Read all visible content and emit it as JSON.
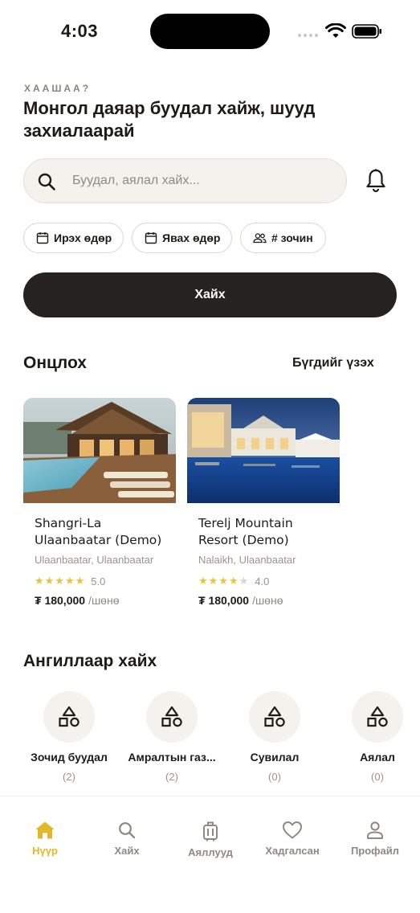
{
  "status_bar": {
    "time": "4:03"
  },
  "header": {
    "eyebrow": "ХААШАА?",
    "headline": "Монгол даяар буудал хайж, шууд захиалаарай"
  },
  "search": {
    "placeholder": "Буудал, аялал хайх..."
  },
  "filters": {
    "arrive": "Ирэх өдөр",
    "leave": "Явах өдөр",
    "guests": "# зочин"
  },
  "search_button": "Хайх",
  "featured": {
    "title": "Онцлох",
    "see_all": "Бүгдийг үзэх",
    "items": [
      {
        "name": "Shangri-La Ulaanbaatar (Demo)",
        "location": "Ulaanbaatar, Ulaanbaatar",
        "rating": "5.0",
        "stars": 5,
        "price": "₮ 180,000",
        "unit": "/шөнө"
      },
      {
        "name": "Terelj Mountain Resort (Demo)",
        "location": "Nalaikh, Ulaanbaatar",
        "rating": "4.0",
        "stars": 4,
        "price": "₮ 180,000",
        "unit": "/шөнө"
      }
    ]
  },
  "categories": {
    "title": "Ангиллаар хайх",
    "items": [
      {
        "label": "Зочид буудал",
        "count": "(2)"
      },
      {
        "label": "Амралтын газ...",
        "count": "(2)"
      },
      {
        "label": "Сувилал",
        "count": "(0)"
      },
      {
        "label": "Аялал",
        "count": "(0)"
      }
    ]
  },
  "tabs": [
    {
      "label": "Нүүр",
      "icon": "home-icon",
      "active": true
    },
    {
      "label": "Хайх",
      "icon": "search-icon"
    },
    {
      "label": "Аяллууд",
      "icon": "luggage-icon"
    },
    {
      "label": "Хадгалсан",
      "icon": "heart-icon"
    },
    {
      "label": "Профайл",
      "icon": "user-icon"
    }
  ],
  "colors": {
    "accent": "#e5b829",
    "primary_button": "#25221f",
    "star": "#e8c43a"
  }
}
